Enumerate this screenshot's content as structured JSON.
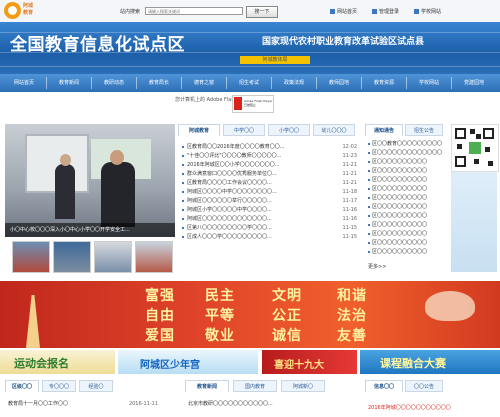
{
  "header": {
    "logo_text_line1": "阿城",
    "logo_text_line2": "教育",
    "search_label": "站内搜索",
    "search_placeholder": "请输入搜索关键词",
    "search_button": "搜一下",
    "links": [
      "网站首页",
      "管理登录",
      "学校网站"
    ]
  },
  "banner": {
    "title": "全国教育信息化试点区",
    "subtitle": "国家现代农村职业教育改革试验区试点县",
    "strip_text": "阿城教体局"
  },
  "nav": {
    "items": [
      "网站首页",
      "教育新闻",
      "教研动态",
      "教育局长",
      "德育之窗",
      "招生考试",
      "政策法规",
      "教师园地",
      "教育资源",
      "学校网站",
      "党建园地"
    ]
  },
  "flash": {
    "notice": "您计算机上的 Adobe Flash Player...",
    "badge_line1": "Adobe Flash Player",
    "badge_line2": "已被阻止"
  },
  "photo": {
    "caption": "小〇中心校〇〇〇深入小〇中心小学〇〇开学安全工..."
  },
  "news": {
    "tabs": [
      "阿城教育",
      "中学〇〇",
      "小学〇〇",
      "幼儿〇〇〇"
    ],
    "rows": [
      {
        "title": "区教育局〇〇2016年度〇〇〇〇教育〇〇...",
        "date": "12-02"
      },
      {
        "title": "\"十佳〇〇评比\"〇〇〇〇教师〇〇〇〇〇...",
        "date": "11-23"
      },
      {
        "title": "2016年阿城区〇〇小学〇〇〇〇〇〇〇...",
        "date": "11-21"
      },
      {
        "title": "群众满意窗口〇〇〇〇优秀服务单位〇...",
        "date": "11-21"
      },
      {
        "title": "区教育局〇〇〇〇工作会议〇〇〇〇...",
        "date": "11-21"
      },
      {
        "title": "阿城区〇〇〇〇中学〇〇〇〇〇〇〇〇...",
        "date": "11-18"
      },
      {
        "title": "阿城区〇〇〇〇〇〇举行〇〇〇〇〇...",
        "date": "11-17"
      },
      {
        "title": "阿城区小学〇〇〇〇〇中学〇〇〇〇...",
        "date": "11-16"
      },
      {
        "title": "阿城区〇〇〇〇〇〇〇〇〇〇〇〇〇...",
        "date": "11-16"
      },
      {
        "title": "区第八〇〇〇〇〇〇〇〇〇学〇〇〇...",
        "date": "11-15"
      },
      {
        "title": "区成人〇〇〇学〇〇〇〇〇〇〇〇〇...",
        "date": "11-15"
      }
    ]
  },
  "right": {
    "tabs": [
      "通知通告",
      "招生公告"
    ],
    "rows": [
      "区〇〇教育〇〇〇〇〇〇〇〇〇",
      "区〇〇〇〇〇〇〇〇〇〇〇〇〇",
      "区〇〇〇〇〇〇〇〇〇〇",
      "区〇〇〇〇〇〇〇〇〇〇",
      "区〇〇〇〇〇〇〇〇〇〇",
      "区〇〇〇〇〇〇〇〇〇〇",
      "区〇〇〇〇〇〇〇〇〇〇",
      "区〇〇〇〇〇〇〇〇〇〇",
      "区〇〇〇〇〇〇〇〇〇〇",
      "区〇〇〇〇〇〇〇〇〇〇",
      "区〇〇〇〇〇〇〇〇〇〇",
      "区〇〇〇〇〇〇〇〇〇〇",
      "区〇〇〇〇〇〇〇〇〇〇"
    ],
    "more": "更多>>"
  },
  "slogan": {
    "row1": [
      "富强",
      "民主",
      "文明",
      "和谐"
    ],
    "row2": [
      "自由",
      "平等",
      "公正",
      "法治"
    ],
    "row3": [
      "爱国",
      "敬业",
      "诚信",
      "友善"
    ]
  },
  "promos": {
    "p1": "运动会报名",
    "p2": "阿城区少年宫",
    "p3": "喜迎十九大",
    "p4": "课程融合大赛"
  },
  "bottom": {
    "left_tabs": [
      "区级〇〇",
      "专〇〇〇",
      "经验〇"
    ],
    "left_row": {
      "title": "教育局十一月〇〇工作〇〇",
      "date": "2016-11-11"
    },
    "mid_tabs": [
      "教育新闻",
      "国内教育",
      "阿城新〇"
    ],
    "mid_row": "北京市教研〇〇〇〇〇〇〇〇〇〇〇...",
    "right_tabs": [
      "信息〇〇",
      "〇〇公告"
    ],
    "right_row": "2016年阿城〇〇〇〇〇〇〇〇〇〇〇"
  }
}
